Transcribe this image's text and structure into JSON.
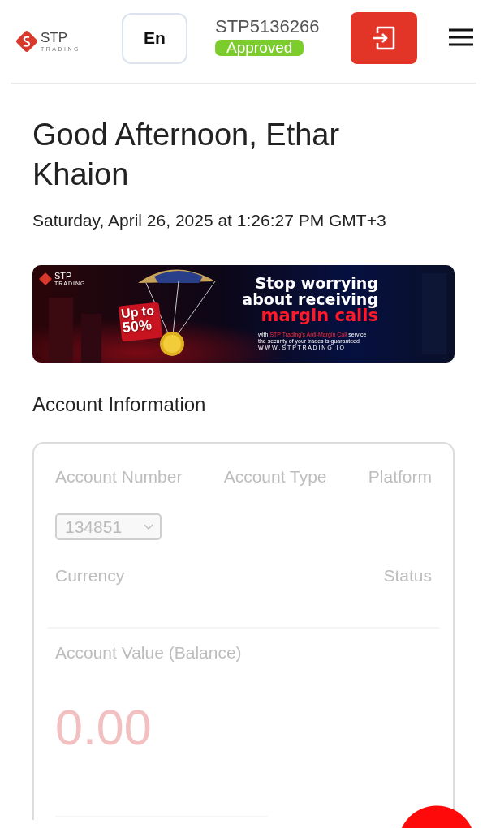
{
  "header": {
    "logo_name": "STP",
    "logo_tagline": "TRADING",
    "language": "En",
    "account_id": "STP5136266",
    "status_badge": "Approved"
  },
  "greeting": "Good Afternoon, Ethar Khaion",
  "datetime": "Saturday, April 26, 2025 at 1:26:27 PM GMT+3",
  "banner": {
    "logo_name": "STP",
    "logo_tagline": "TRADING",
    "offer_line1": "Up to",
    "offer_line2": "50%",
    "headline1": "Stop worrying",
    "headline2": "about receiving",
    "headline3": "margin calls",
    "note_brand": "STP Trading's Anti-Margin Call",
    "note_prefix": "with",
    "note_suffix": "service",
    "note_line2": "the security of your trades is guaranteed",
    "website": "W W W . S T P T R A D I N G . I O"
  },
  "account": {
    "title": "Account Information",
    "columns": [
      "Account Number",
      "Account Type",
      "Platform"
    ],
    "account_select": "134851",
    "currency_label": "Currency",
    "status_label": "Status",
    "balance_label": "Account Value (Balance)",
    "balance": "0.00"
  }
}
